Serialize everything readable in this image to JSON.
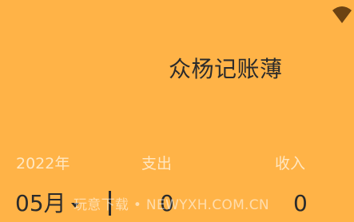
{
  "header": {
    "app_title": "众杨记账薄",
    "status_icon": "wifi-icon"
  },
  "summary": {
    "year_label": "2022年",
    "expense_label": "支出",
    "income_label": "收入",
    "month_value": "05月",
    "month_dropdown_icon": "chevron-down-icon",
    "expense_value": "0",
    "income_value": "0"
  },
  "watermark": {
    "text": "玩意下载 • NEWYXH.COM.CN"
  },
  "colors": {
    "background": "#FFB347",
    "title_text": "#2b2b2b",
    "label_text": "#FFE7C2"
  }
}
